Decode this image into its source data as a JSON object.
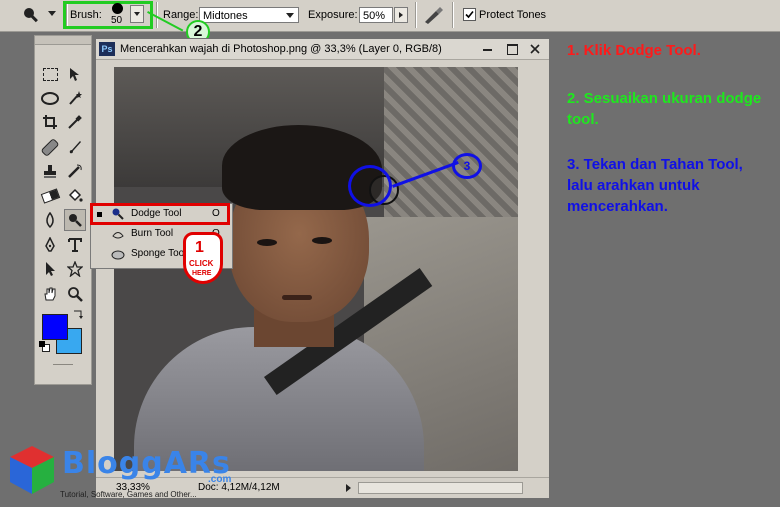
{
  "options_bar": {
    "brush_label": "Brush:",
    "brush_size": "50",
    "range_label": "Range:",
    "range_value": "Midtones",
    "exposure_label": "Exposure:",
    "exposure_value": "50%",
    "protect_tones_label": "Protect Tones",
    "protect_tones_checked": true
  },
  "document": {
    "icon_text": "Ps",
    "title": "Mencerahkan wajah di Photoshop.png @ 33,3% (Layer 0, RGB/8)",
    "zoom": "33,33%",
    "doc_info": "Doc: 4,12M/4,12M"
  },
  "tool_flyout": {
    "items": [
      {
        "label": "Dodge Tool",
        "shortcut": "O",
        "selected": true
      },
      {
        "label": "Burn Tool",
        "shortcut": "O",
        "selected": false
      },
      {
        "label": "Sponge Tool",
        "shortcut": "O",
        "selected": false
      }
    ]
  },
  "annotations": {
    "step1_number": "1",
    "step1_click": "CLICK",
    "step1_here": "HERE",
    "step2_number": "2",
    "step3_number": "3"
  },
  "instructions": {
    "step1": "1. Klik Dodge Tool.",
    "step2": "2. Sesuaikan ukuran dodge tool.",
    "step3": "3. Tekan dan Tahan Tool, lalu arahkan untuk mencerahkan."
  },
  "watermark": {
    "brand": "BloggARs",
    "domain": ".com",
    "tagline": "Tutorial, Software, Games and Other..."
  },
  "colors": {
    "foreground": "#0000ff",
    "background": "#38a8f0",
    "step1_red": "#ff1a1a",
    "step2_green": "#1ee81e",
    "step3_blue": "#1010e6",
    "highlight_red": "#e00000",
    "highlight_green": "#22cc22"
  },
  "icons": {
    "tool_preset": "dodge-preset-icon",
    "brush_picker": "chevron-down-icon",
    "airbrush": "airbrush-icon"
  }
}
